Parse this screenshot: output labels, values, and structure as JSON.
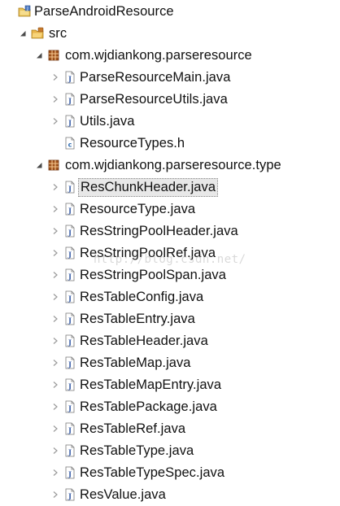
{
  "tree": [
    {
      "label": "ParseAndroidResource",
      "depth": 0,
      "icon": "project-icon",
      "twisty": "none",
      "kind": "project"
    },
    {
      "label": "src",
      "depth": 1,
      "icon": "source-folder-icon",
      "twisty": "expanded",
      "kind": "folder"
    },
    {
      "label": "com.wjdiankong.parseresource",
      "depth": 2,
      "icon": "package-icon",
      "twisty": "expanded",
      "kind": "package"
    },
    {
      "label": "ParseResourceMain.java",
      "depth": 3,
      "icon": "java-file-icon",
      "twisty": "collapsed",
      "kind": "java"
    },
    {
      "label": "ParseResourceUtils.java",
      "depth": 3,
      "icon": "java-file-icon",
      "twisty": "collapsed",
      "kind": "java"
    },
    {
      "label": "Utils.java",
      "depth": 3,
      "icon": "java-file-icon",
      "twisty": "collapsed",
      "kind": "java"
    },
    {
      "label": "ResourceTypes.h",
      "depth": 3,
      "icon": "c-header-file-icon",
      "twisty": "none",
      "kind": "header"
    },
    {
      "label": "com.wjdiankong.parseresource.type",
      "depth": 2,
      "icon": "package-icon",
      "twisty": "expanded",
      "kind": "package"
    },
    {
      "label": "ResChunkHeader.java",
      "depth": 3,
      "icon": "java-file-icon",
      "twisty": "collapsed",
      "kind": "java",
      "selected": true
    },
    {
      "label": "ResourceType.java",
      "depth": 3,
      "icon": "java-file-icon",
      "twisty": "collapsed",
      "kind": "java"
    },
    {
      "label": "ResStringPoolHeader.java",
      "depth": 3,
      "icon": "java-file-icon",
      "twisty": "collapsed",
      "kind": "java"
    },
    {
      "label": "ResStringPoolRef.java",
      "depth": 3,
      "icon": "java-file-icon",
      "twisty": "collapsed",
      "kind": "java"
    },
    {
      "label": "ResStringPoolSpan.java",
      "depth": 3,
      "icon": "java-file-icon",
      "twisty": "collapsed",
      "kind": "java"
    },
    {
      "label": "ResTableConfig.java",
      "depth": 3,
      "icon": "java-file-icon",
      "twisty": "collapsed",
      "kind": "java"
    },
    {
      "label": "ResTableEntry.java",
      "depth": 3,
      "icon": "java-file-icon",
      "twisty": "collapsed",
      "kind": "java"
    },
    {
      "label": "ResTableHeader.java",
      "depth": 3,
      "icon": "java-file-icon",
      "twisty": "collapsed",
      "kind": "java"
    },
    {
      "label": "ResTableMap.java",
      "depth": 3,
      "icon": "java-file-icon",
      "twisty": "collapsed",
      "kind": "java"
    },
    {
      "label": "ResTableMapEntry.java",
      "depth": 3,
      "icon": "java-file-icon",
      "twisty": "collapsed",
      "kind": "java"
    },
    {
      "label": "ResTablePackage.java",
      "depth": 3,
      "icon": "java-file-icon",
      "twisty": "collapsed",
      "kind": "java"
    },
    {
      "label": "ResTableRef.java",
      "depth": 3,
      "icon": "java-file-icon",
      "twisty": "collapsed",
      "kind": "java"
    },
    {
      "label": "ResTableType.java",
      "depth": 3,
      "icon": "java-file-icon",
      "twisty": "collapsed",
      "kind": "java"
    },
    {
      "label": "ResTableTypeSpec.java",
      "depth": 3,
      "icon": "java-file-icon",
      "twisty": "collapsed",
      "kind": "java"
    },
    {
      "label": "ResValue.java",
      "depth": 3,
      "icon": "java-file-icon",
      "twisty": "collapsed",
      "kind": "java"
    }
  ],
  "watermark": "http://blog.csdn.net/",
  "colors": {
    "package": "#a0521c",
    "folder": "#d9a43a",
    "java_icon": "#3b5fa8",
    "twisty": "#555555",
    "selected_bg": "#e8e8e8"
  }
}
